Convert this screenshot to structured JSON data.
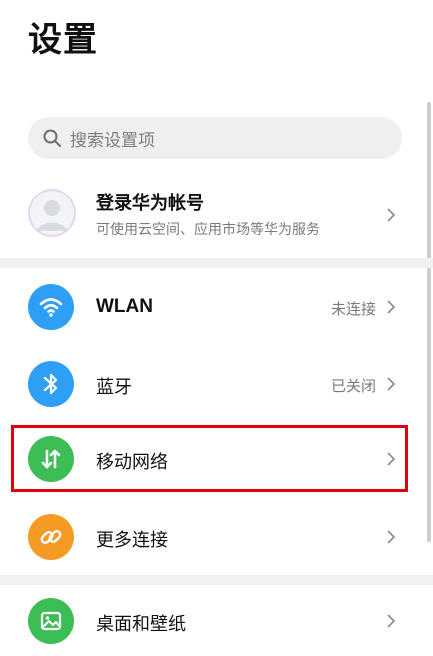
{
  "header": {
    "title": "设置"
  },
  "search": {
    "placeholder": "搜索设置项"
  },
  "account": {
    "title": "登录华为帐号",
    "subtitle": "可使用云空间、应用市场等华为服务"
  },
  "rows": [
    {
      "label": "WLAN",
      "status": "未连接",
      "icon": "wifi-icon",
      "color": "#2f9ff6"
    },
    {
      "label": "蓝牙",
      "status": "已关闭",
      "icon": "bluetooth-icon",
      "color": "#2f9ff6"
    },
    {
      "label": "移动网络",
      "status": "",
      "icon": "mobile-data-icon",
      "color": "#3dbd55"
    },
    {
      "label": "更多连接",
      "status": "",
      "icon": "link-icon",
      "color": "#f59a23"
    },
    {
      "label": "桌面和壁纸",
      "status": "",
      "icon": "wallpaper-icon",
      "color": "#3dbd55"
    }
  ],
  "colors": {
    "highlight": "#e0000b"
  }
}
